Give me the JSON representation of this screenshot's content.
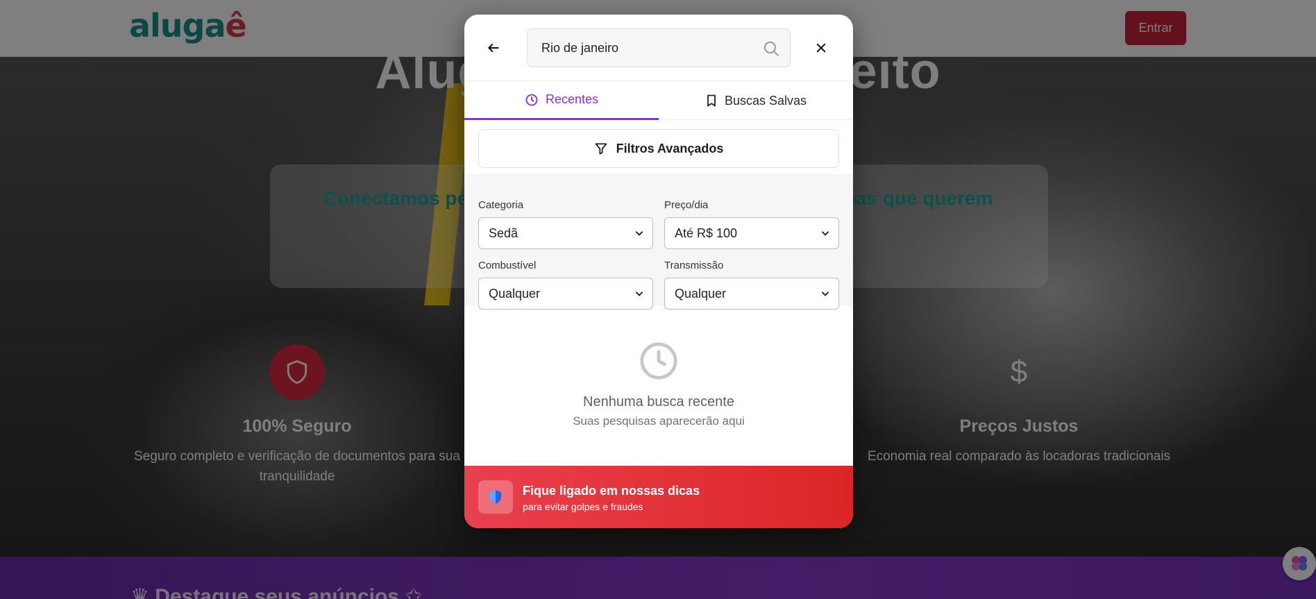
{
  "background": {
    "logo": {
      "part1": "aluga",
      "part2": "ê"
    },
    "login_label": "Entrar",
    "hero_title": "Alugue o carro perfeito",
    "hero_subtitle": "Conectamos pessoas que têm carros parados com pessoas que querem",
    "features": [
      {
        "icon": "shield-icon",
        "title": "100% Seguro",
        "text": "Seguro completo e verificação de documentos para sua tranquilidade"
      },
      {
        "icon": "dollar-icon",
        "title": "Preços Justos",
        "text": "Economia real comparado às locadoras tradicionais"
      }
    ],
    "promo_title": "♛ Destaque seus anúncios ✩"
  },
  "search": {
    "value": "Rio de janeiro",
    "placeholder": "Rio de janeiro"
  },
  "tabs": [
    {
      "label": "Recentes",
      "active": true,
      "icon": "clock-icon"
    },
    {
      "label": "Buscas Salvas",
      "active": false,
      "icon": "bookmark-icon"
    }
  ],
  "filters_button_label": "Filtros Avançados",
  "filters": {
    "categoria": {
      "label": "Categoria",
      "value": "Sedã"
    },
    "preco": {
      "label": "Preço/dia",
      "value": "Até R$ 100"
    },
    "combustivel": {
      "label": "Combustível",
      "value": "Qualquer"
    },
    "transmissao": {
      "label": "Transmissão",
      "value": "Qualquer"
    }
  },
  "empty_state": {
    "title": "Nenhuma busca recente",
    "subtitle": "Suas pesquisas aparecerão aqui"
  },
  "tip": {
    "title": "Fique ligado em nossas dicas",
    "subtitle": "para evitar golpes e fraudes"
  },
  "colors": {
    "accent_purple": "#8b2fd6",
    "brand_red": "#c8213a",
    "brand_teal": "#1b8f8a",
    "tip_red": "#dc2626"
  }
}
